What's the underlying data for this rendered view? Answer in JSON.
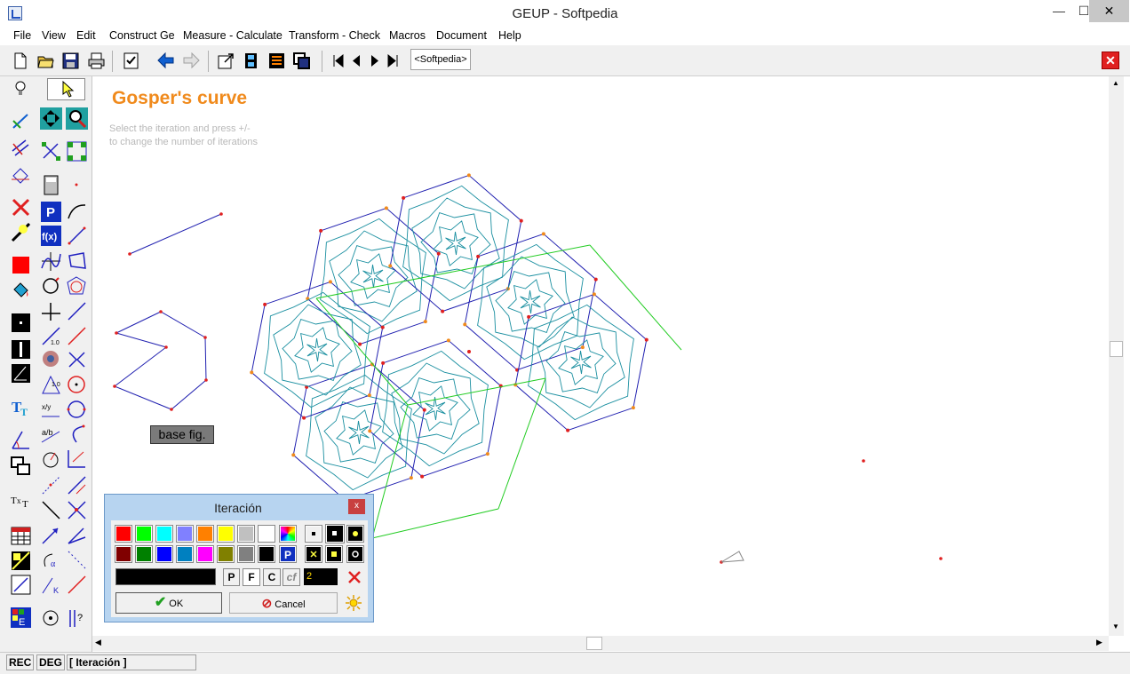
{
  "window": {
    "title": "GEUP - Softpedia",
    "minimize": "—",
    "maximize": "☐",
    "close": "✕"
  },
  "menu": [
    "File",
    "View",
    "Edit",
    "Construct Ge",
    "Measure - Calculate",
    "Transform - Check",
    "Macros",
    "Document",
    "Help"
  ],
  "toolbar": {
    "tab_label": "<Softpedia>",
    "close_label": "✕"
  },
  "canvas": {
    "heading": "Gosper's curve",
    "hint_line1": "Select the iteration and press +/-",
    "hint_line2": "to change the number of iterations",
    "base_button": "base fig."
  },
  "dialog": {
    "title": "Iteración",
    "close_label": "x",
    "row1_colors": [
      "#ff0000",
      "#00ff00",
      "#00ffff",
      "#8080ff",
      "#ff8000",
      "#ffff00",
      "#c0c0c0",
      "#ffffff"
    ],
    "row2_colors": [
      "#800000",
      "#008000",
      "#0000ff",
      "#0080c0",
      "#ff00ff",
      "#808000",
      "#808080",
      "#000000"
    ],
    "btn_p": "P",
    "btn_f": "F",
    "btn_c": "C",
    "btn_cf": "cf",
    "iterations": "2",
    "ok_label": "OK",
    "cancel_label": "Cancel"
  },
  "status": {
    "rec": "REC",
    "deg": "DEG",
    "mode": "[ Iteración ]"
  },
  "colors": {
    "accent_title": "#f08a1c",
    "curve": "#1a8fa0",
    "hex_outline": "#2020b0",
    "green_lines": "#22cc22",
    "red_points": "#e02020",
    "orange_points": "#f08a1c"
  }
}
